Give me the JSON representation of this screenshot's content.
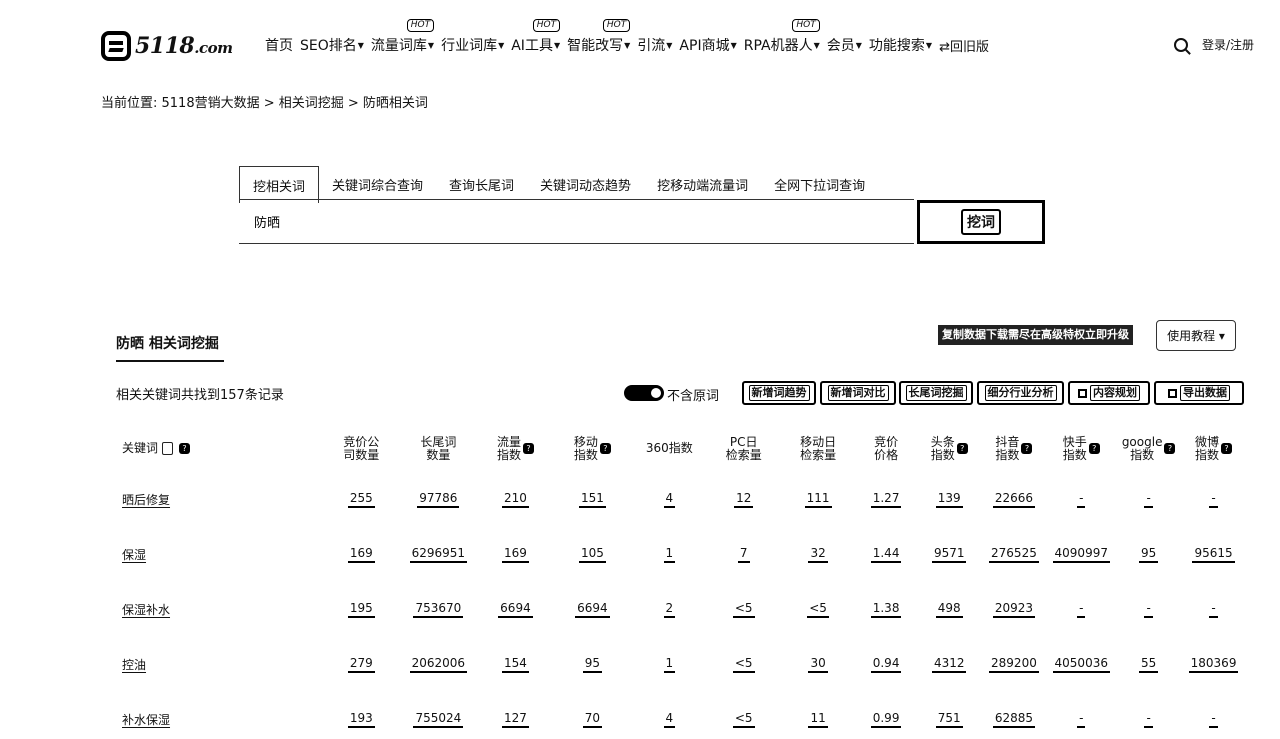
{
  "header": {
    "logo_main": "5118",
    "logo_suffix": ".com",
    "nav": [
      {
        "label": "首页",
        "caret": false,
        "hot": false
      },
      {
        "label": "SEO排名",
        "caret": true,
        "hot": false
      },
      {
        "label": "流量词库",
        "caret": true,
        "hot": true
      },
      {
        "label": "行业词库",
        "caret": true,
        "hot": false
      },
      {
        "label": "AI工具",
        "caret": true,
        "hot": true
      },
      {
        "label": "智能改写",
        "caret": true,
        "hot": true
      },
      {
        "label": "引流",
        "caret": true,
        "hot": false
      },
      {
        "label": "API商城",
        "caret": true,
        "hot": false
      },
      {
        "label": "RPA机器人",
        "caret": true,
        "hot": true
      },
      {
        "label": "会员",
        "caret": true,
        "hot": false
      },
      {
        "label": "功能搜索",
        "caret": true,
        "hot": false
      },
      {
        "label": "⇄回旧版",
        "caret": false,
        "hot": false
      }
    ],
    "hot_label": "HOT",
    "login": "登录/注册"
  },
  "breadcrumb": "当前位置: 5118营销大数据 > 相关词挖掘 > 防晒相关词",
  "search": {
    "tabs": [
      "挖相关词",
      "关键词综合查询",
      "查询长尾词",
      "关键词动态趋势",
      "挖移动端流量词",
      "全网下拉词查询"
    ],
    "active_tab": 0,
    "value": "防晒",
    "button": "挖词"
  },
  "section": {
    "title": "防晒 相关词挖掘",
    "copy_banner": "复制数据下载需尽在高级特权立即升级",
    "tutorial": "使用教程 ▾",
    "record_count": "相关关键词共找到157条记录",
    "toggle_label": "不含原词",
    "tools": [
      "新增词趋势",
      "新增词对比",
      "长尾词挖掘",
      "细分行业分析",
      "内容规划",
      "导出数据"
    ]
  },
  "table": {
    "headers": [
      "关键词",
      "竞价公司数量",
      "长尾词数量",
      "流量指数",
      "移动指数",
      "360指数",
      "PC日检索量",
      "移动日检索量",
      "竞价价格",
      "头条指数",
      "抖音指数",
      "快手指数",
      "google指数",
      "微博指数"
    ],
    "header_lines": [
      [
        "关键词"
      ],
      [
        "竞价公",
        "司数量"
      ],
      [
        "长尾词",
        "数量"
      ],
      [
        "流量",
        "指数"
      ],
      [
        "移动",
        "指数"
      ],
      [
        "360指数"
      ],
      [
        "PC日",
        "检索量"
      ],
      [
        "移动日",
        "检索量"
      ],
      [
        "竞价",
        "价格"
      ],
      [
        "头条",
        "指数"
      ],
      [
        "抖音",
        "指数"
      ],
      [
        "快手",
        "指数"
      ],
      [
        "google",
        "指数"
      ],
      [
        "微博",
        "指数"
      ]
    ],
    "rows": [
      [
        "晒后修复",
        "255",
        "97786",
        "210",
        "151",
        "4",
        "12",
        "111",
        "1.27",
        "139",
        "22666",
        "-",
        "-",
        "-"
      ],
      [
        "保湿",
        "169",
        "6296951",
        "169",
        "105",
        "1",
        "7",
        "32",
        "1.44",
        "9571",
        "276525",
        "4090997",
        "95",
        "95615"
      ],
      [
        "保湿补水",
        "195",
        "753670",
        "6694",
        "6694",
        "2",
        "<5",
        "<5",
        "1.38",
        "498",
        "20923",
        "-",
        "-",
        "-"
      ],
      [
        "控油",
        "279",
        "2062006",
        "154",
        "95",
        "1",
        "<5",
        "30",
        "0.94",
        "4312",
        "289200",
        "4050036",
        "55",
        "180369"
      ],
      [
        "补水保湿",
        "193",
        "755024",
        "127",
        "70",
        "4",
        "<5",
        "11",
        "0.99",
        "751",
        "62885",
        "-",
        "-",
        "-"
      ]
    ]
  }
}
